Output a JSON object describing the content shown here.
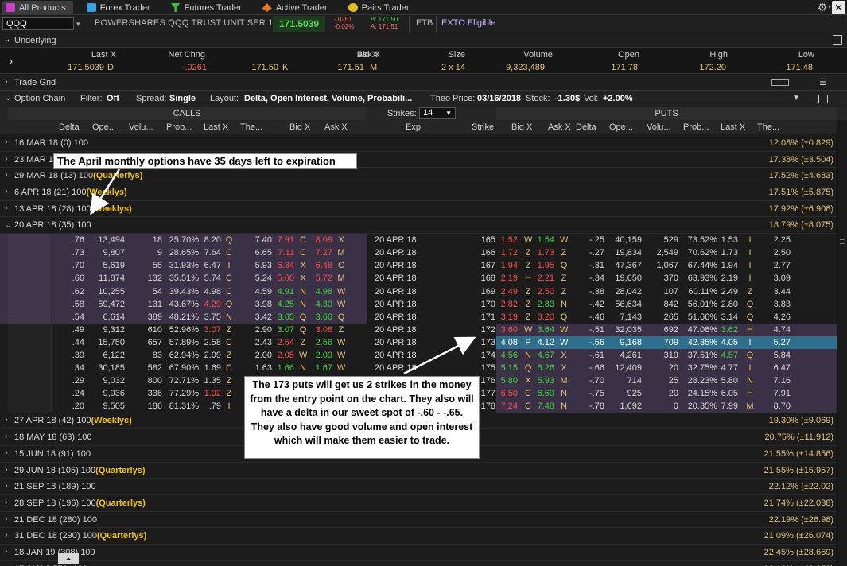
{
  "tabs": [
    {
      "label": "All Products",
      "active": true,
      "icon": "all-products-icon",
      "color": "#c840c8"
    },
    {
      "label": "Forex Trader",
      "icon": "forex-icon",
      "color": "#3aa0e0"
    },
    {
      "label": "Futures Trader",
      "icon": "futures-icon",
      "color": "#3ac03a"
    },
    {
      "label": "Active Trader",
      "icon": "active-trader-icon",
      "color": "#e07a2a"
    },
    {
      "label": "Pairs Trader",
      "icon": "pairs-trader-icon",
      "color": "#e0c020"
    }
  ],
  "quote": {
    "symbol": "QQQ",
    "name": "POWERSHARES QQQ TRUST UNIT SER 1 ETF",
    "last": "171.5039",
    "chg": "-.0261",
    "chg_pct": "-0.02%",
    "bid": "B: 171.50",
    "ask": "A: 171.51",
    "etb": "ETB",
    "exto": "EXTO Eligible"
  },
  "underlying": {
    "section_label": "Underlying",
    "headers": [
      "Last X",
      "Net Chng",
      "Bid X",
      "Ask X",
      "Size",
      "Volume",
      "Open",
      "High",
      "Low"
    ],
    "values": {
      "last": "171.5039",
      "last_ex": "D",
      "net": "-.0261",
      "bid": "171.50",
      "bid_ex": "K",
      "ask": "171.51",
      "ask_ex": "M",
      "size": "2 x 14",
      "volume": "9,323,489",
      "open": "171.78",
      "high": "172.20",
      "low": "171.48"
    }
  },
  "trade_grid_label": "Trade Grid",
  "option_chain": {
    "label": "Option Chain",
    "filter_label": "Filter:",
    "filter_value": "Off",
    "spread_label": "Spread:",
    "spread_value": "Single",
    "layout_label": "Layout:",
    "layout_value": "Delta, Open Interest, Volume, Probabili...",
    "theo_label": "Theo Price:",
    "theo_date": "03/16/2018",
    "stock_label": "Stock:",
    "stock_value": "-1.30$",
    "vol_label": "Vol:",
    "vol_value": "+2.00%",
    "strikes_label": "Strikes:",
    "strikes_value": "14",
    "calls_label": "CALLS",
    "puts_label": "PUTS"
  },
  "call_headers": [
    "Delta",
    "Ope...",
    "Volu...",
    "Prob...",
    "Last X",
    "The...",
    "Bid X",
    "Ask X"
  ],
  "mid_headers": [
    "Exp",
    "Strike"
  ],
  "put_headers": [
    "Bid X",
    "Ask X",
    "Delta",
    "Ope...",
    "Volu...",
    "Prob...",
    "Last X",
    "The..."
  ],
  "series_before": [
    {
      "exp": "16 MAR 18",
      "days": "(0)",
      "mult": "100",
      "tag": "",
      "iv": "12.08% (±0.829)"
    },
    {
      "exp": "23 MAR 18",
      "days": "(7)",
      "mult": "100",
      "tag": "",
      "iv": "17.38% (±3.504)"
    },
    {
      "exp": "29 MAR 18",
      "days": "(13)",
      "mult": "100",
      "tag": "(Quarterlys)",
      "iv": "17.52% (±4.683)"
    },
    {
      "exp": "6 APR 18",
      "days": "(21)",
      "mult": "100",
      "tag": "(Weeklys)",
      "iv": "17.51% (±5.875)"
    },
    {
      "exp": "13 APR 18",
      "days": "(28)",
      "mult": "100",
      "tag": "(Weeklys)",
      "iv": "17.92% (±6.908)"
    }
  ],
  "open_series": {
    "exp": "20 APR 18",
    "days": "(35)",
    "mult": "100",
    "tag": "",
    "iv": "18.79% (±8.075)"
  },
  "option_rows": [
    {
      "d": ".76",
      "oi": "13,494",
      "v": "18",
      "p": "25.70%",
      "l": "8.20",
      "lx": "Q",
      "t": "7.40",
      "b": "7.91",
      "bx": "C",
      "a": "8.09",
      "ax": "X",
      "exp": "20 APR 18",
      "k": "165",
      "pb": "1.52",
      "pbx": "W",
      "pa": "1.54",
      "pax": "W",
      "pd": "-.25",
      "poi": "40,159",
      "pv": "529",
      "pp": "73.52%",
      "pl": "1.53",
      "plx": "I",
      "pt": "2.25"
    },
    {
      "d": ".73",
      "oi": "9,807",
      "v": "9",
      "p": "28.65%",
      "l": "7.64",
      "lx": "C",
      "t": "6.65",
      "b": "7.11",
      "bx": "C",
      "a": "7.27",
      "ax": "M",
      "exp": "20 APR 18",
      "k": "166",
      "pb": "1.72",
      "pbx": "Z",
      "pa": "1.73",
      "pax": "Z",
      "pd": "-.27",
      "poi": "19,834",
      "pv": "2,549",
      "pp": "70.62%",
      "pl": "1.73",
      "plx": "I",
      "pt": "2.50"
    },
    {
      "d": ".70",
      "oi": "5,619",
      "v": "55",
      "p": "31.93%",
      "l": "6.47",
      "lx": "I",
      "t": "5.93",
      "b": "6.34",
      "bx": "X",
      "a": "6.48",
      "ax": "C",
      "exp": "20 APR 18",
      "k": "167",
      "pb": "1.94",
      "pbx": "Z",
      "pa": "1.95",
      "pax": "Q",
      "pd": "-.31",
      "poi": "47,367",
      "pv": "1,067",
      "pp": "67.44%",
      "pl": "1.94",
      "plx": "I",
      "pt": "2.77"
    },
    {
      "d": ".66",
      "oi": "11,874",
      "v": "132",
      "p": "35.51%",
      "l": "5.74",
      "lx": "C",
      "t": "5.24",
      "b": "5.60",
      "bx": "X",
      "a": "5.72",
      "ax": "M",
      "exp": "20 APR 18",
      "k": "168",
      "pb": "2.19",
      "pbx": "H",
      "pa": "2.21",
      "pax": "Z",
      "pd": "-.34",
      "poi": "19,650",
      "pv": "370",
      "pp": "63.93%",
      "pl": "2.19",
      "plx": "I",
      "pt": "3.09"
    },
    {
      "d": ".62",
      "oi": "10,255",
      "v": "54",
      "p": "39.43%",
      "l": "4.98",
      "lx": "C",
      "t": "4.59",
      "b": "4.91",
      "bx": "N",
      "a": "4.98",
      "ax": "W",
      "exp": "20 APR 18",
      "k": "169",
      "pb": "2.49",
      "pbx": "Z",
      "pa": "2.50",
      "pax": "Z",
      "pd": "-.38",
      "poi": "28,042",
      "pv": "107",
      "pp": "60.11%",
      "pl": "2.49",
      "plx": "Z",
      "pt": "3.44"
    },
    {
      "d": ".58",
      "oi": "59,472",
      "v": "131",
      "p": "43.67%",
      "l": "4.29",
      "lx": "Q",
      "t": "3.98",
      "b": "4.25",
      "bx": "N",
      "a": "4.30",
      "ax": "W",
      "exp": "20 APR 18",
      "k": "170",
      "pb": "2.82",
      "pbx": "Z",
      "pa": "2.83",
      "pax": "N",
      "pd": "-.42",
      "poi": "56,634",
      "pv": "842",
      "pp": "56.01%",
      "pl": "2.80",
      "plx": "Q",
      "pt": "3.83"
    },
    {
      "d": ".54",
      "oi": "6,614",
      "v": "389",
      "p": "48.21%",
      "l": "3.75",
      "lx": "N",
      "t": "3.42",
      "b": "3.65",
      "bx": "Q",
      "a": "3.66",
      "ax": "Q",
      "exp": "20 APR 18",
      "k": "171",
      "pb": "3.19",
      "pbx": "Z",
      "pa": "3.20",
      "pax": "Q",
      "pd": "-.46",
      "poi": "7,143",
      "pv": "265",
      "pp": "51.66%",
      "pl": "3.14",
      "plx": "Q",
      "pt": "4.26"
    },
    {
      "d": ".49",
      "oi": "9,312",
      "v": "610",
      "p": "52.96%",
      "l": "3.07",
      "lx": "Z",
      "t": "2.90",
      "b": "3.07",
      "bx": "Q",
      "a": "3.08",
      "ax": "Z",
      "exp": "20 APR 18",
      "k": "172",
      "pb": "3.60",
      "pbx": "W",
      "pa": "3.64",
      "pax": "W",
      "pd": "-.51",
      "poi": "32,035",
      "pv": "692",
      "pp": "47.08%",
      "pl": "3.62",
      "plx": "H",
      "pt": "4.74"
    },
    {
      "d": ".44",
      "oi": "15,750",
      "v": "657",
      "p": "57.89%",
      "l": "2.58",
      "lx": "C",
      "t": "2.43",
      "b": "2.54",
      "bx": "Z",
      "a": "2.56",
      "ax": "W",
      "exp": "20 APR 18",
      "k": "173",
      "pb": "4.08",
      "pbx": "P",
      "pa": "4.12",
      "pax": "W",
      "pd": "-.56",
      "poi": "9,168",
      "pv": "709",
      "pp": "42.35%",
      "pl": "4.05",
      "plx": "I",
      "pt": "5.27",
      "selected": true
    },
    {
      "d": ".39",
      "oi": "6,122",
      "v": "83",
      "p": "62.94%",
      "l": "2.09",
      "lx": "Z",
      "t": "2.00",
      "b": "2.05",
      "bx": "W",
      "a": "2.09",
      "ax": "W",
      "exp": "20 APR 18",
      "k": "174",
      "pb": "4.56",
      "pbx": "N",
      "pa": "4.67",
      "pax": "X",
      "pd": "-.61",
      "poi": "4,261",
      "pv": "319",
      "pp": "37.51%",
      "pl": "4.57",
      "plx": "Q",
      "pt": "5.84"
    },
    {
      "d": ".34",
      "oi": "30,185",
      "v": "582",
      "p": "67.90%",
      "l": "1.69",
      "lx": "C",
      "t": "1.63",
      "b": "1.66",
      "bx": "N",
      "a": "1.67",
      "ax": "W",
      "exp": "20 APR 18",
      "k": "175",
      "pb": "5.15",
      "pbx": "Q",
      "pa": "5.26",
      "pax": "X",
      "pd": "-.66",
      "poi": "12,409",
      "pv": "20",
      "pp": "32.75%",
      "pl": "4.77",
      "plx": "I",
      "pt": "6.47"
    },
    {
      "d": ".29",
      "oi": "9,032",
      "v": "800",
      "p": "72.71%",
      "l": "1.35",
      "lx": "Z",
      "t": "1.32",
      "b": "1.31",
      "bx": "Z",
      "a": "1.32",
      "ax": "H",
      "exp": "20 APR 18",
      "k": "176",
      "pb": "5.80",
      "pbx": "X",
      "pa": "5.93",
      "pax": "M",
      "pd": "-.70",
      "poi": "714",
      "pv": "25",
      "pp": "28.23%",
      "pl": "5.80",
      "plx": "N",
      "pt": "7.16"
    },
    {
      "d": ".24",
      "oi": "9,936",
      "v": "336",
      "p": "77.29%",
      "l": "1.02",
      "lx": "Z",
      "t": "",
      "b": "",
      "bx": "",
      "a": "",
      "ax": "",
      "exp": "",
      "k": "177",
      "pb": "6.50",
      "pbx": "C",
      "pa": "6.69",
      "pax": "N",
      "pd": "-.75",
      "poi": "925",
      "pv": "20",
      "pp": "24.15%",
      "pl": "6.05",
      "plx": "H",
      "pt": "7.91"
    },
    {
      "d": ".20",
      "oi": "9,505",
      "v": "186",
      "p": "81.31%",
      "l": ".79",
      "lx": "I",
      "t": ".8",
      "b": "",
      "bx": "",
      "a": "",
      "ax": "",
      "exp": "",
      "k": "178",
      "pb": "7.24",
      "pbx": "C",
      "pa": "7.48",
      "pax": "N",
      "pd": "-.78",
      "poi": "1,692",
      "pv": "0",
      "pp": "20.35%",
      "pl": "7.99",
      "plx": "M",
      "pt": "8.70"
    }
  ],
  "series_after": [
    {
      "exp": "27 APR 18",
      "days": "(42)",
      "mult": "100",
      "tag": "(Weeklys)",
      "iv": "19.30% (±9.069)"
    },
    {
      "exp": "18 MAY 18",
      "days": "(63)",
      "mult": "100",
      "tag": "",
      "iv": "20.75% (±11.912)"
    },
    {
      "exp": "15 JUN 18",
      "days": "(91)",
      "mult": "100",
      "tag": "",
      "iv": "21.55% (±14.856)"
    },
    {
      "exp": "29 JUN 18",
      "days": "(105)",
      "mult": "100",
      "tag": "(Quarterlys)",
      "iv": "21.55% (±15.957)"
    },
    {
      "exp": "21 SEP 18",
      "days": "(189)",
      "mult": "100",
      "tag": "",
      "iv": "22.12% (±22.02)"
    },
    {
      "exp": "28 SEP 18",
      "days": "(196)",
      "mult": "100",
      "tag": "(Quarterlys)",
      "iv": "21.74% (±22.038)"
    },
    {
      "exp": "21 DEC 18",
      "days": "(280)",
      "mult": "100",
      "tag": "",
      "iv": "22.19% (±26.98)"
    },
    {
      "exp": "31 DEC 18",
      "days": "(290)",
      "mult": "100",
      "tag": "(Quarterlys)",
      "iv": "21.09% (±26.074)"
    },
    {
      "exp": "18 JAN 19",
      "days": "(308)",
      "mult": "100",
      "tag": "",
      "iv": "22.45% (±28.669)"
    },
    {
      "exp": "17 JAN 2",
      "days": "572)",
      "mult": "100",
      "tag": "",
      "iv": "22.12% (±42.359)"
    }
  ],
  "annotations": {
    "top": "The April monthly options have 35 days left to expiration",
    "bottom": "The 173 puts will get us 2 strikes in the money from the entry point on the chart. They also will have a delta in our sweet spot of -.60 - -.65. They also have good volume and open interest which will make them easier to trade."
  },
  "colors": {
    "green": "#3fd23f",
    "red": "#ff4a4a",
    "yellow": "#e2c27a",
    "itm": "#3a3147",
    "selected": "#2e6f8e"
  }
}
